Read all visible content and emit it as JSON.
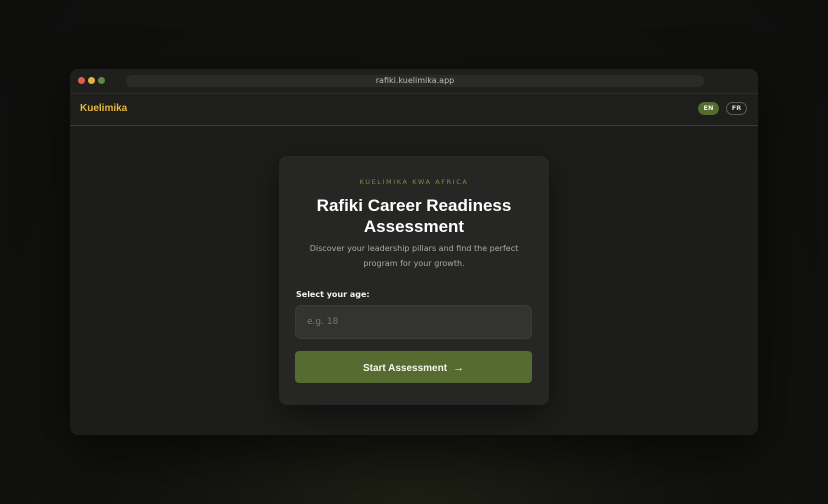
{
  "browser": {
    "url": "rafiki.kuelimika.app"
  },
  "header": {
    "brand": "Kuelimika",
    "languages": [
      {
        "label": "EN",
        "active": true
      },
      {
        "label": "FR",
        "active": false
      }
    ]
  },
  "card": {
    "eyebrow": "KUELIMIKA KWA AFRICA",
    "title": "Rafiki Career Readiness Assessment",
    "subtitle": "Discover your leadership pillars and find the perfect program for your growth.",
    "age_label": "Select your age:",
    "age_input": {
      "value": "",
      "placeholder": "e.g. 18"
    },
    "start_label": "Start Assessment",
    "start_icon": "arrow-right-icon"
  },
  "colors": {
    "accent": "#556b2f",
    "brand": "#e8b83a",
    "eyebrow": "#7c8e47"
  }
}
